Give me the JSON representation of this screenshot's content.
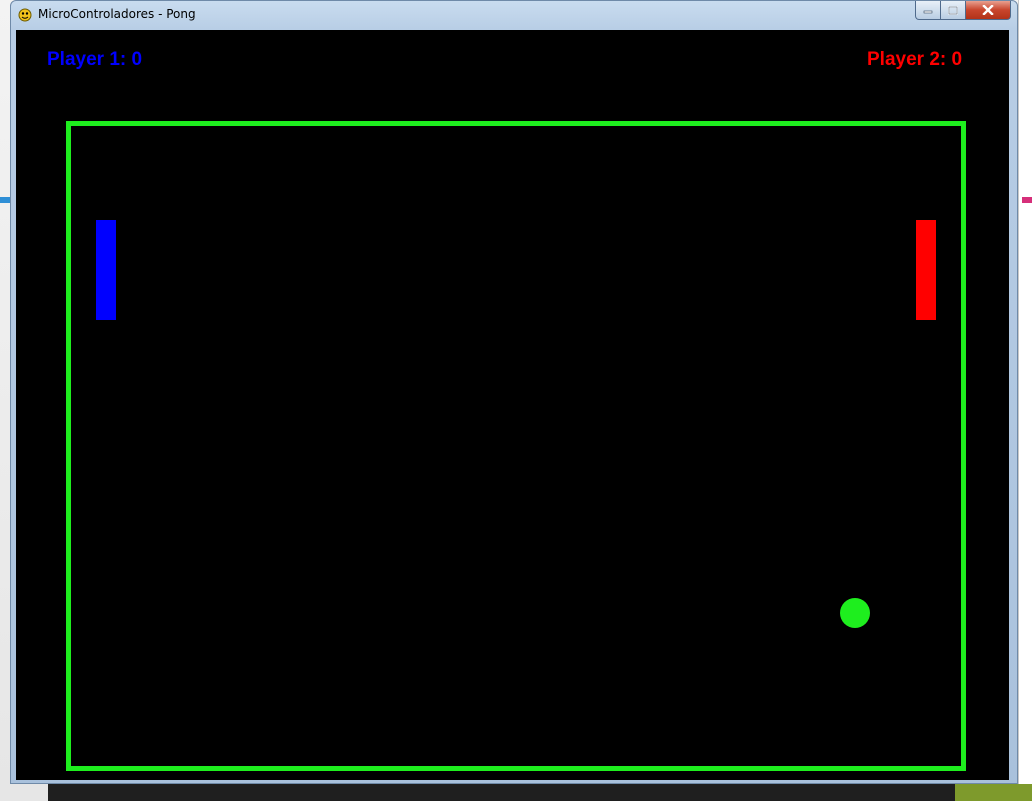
{
  "window": {
    "title": "MicroControladores - Pong",
    "icon": "pygame-snake-icon"
  },
  "scoreboard": {
    "player1": "Player 1: 0",
    "player2": "Player 2: 0",
    "player1_score": 0,
    "player2_score": 0
  },
  "colors": {
    "player1": "#0000ff",
    "player2": "#ff0000",
    "arena_border": "#1eee1e",
    "ball": "#1eee1e",
    "background": "#000000"
  }
}
